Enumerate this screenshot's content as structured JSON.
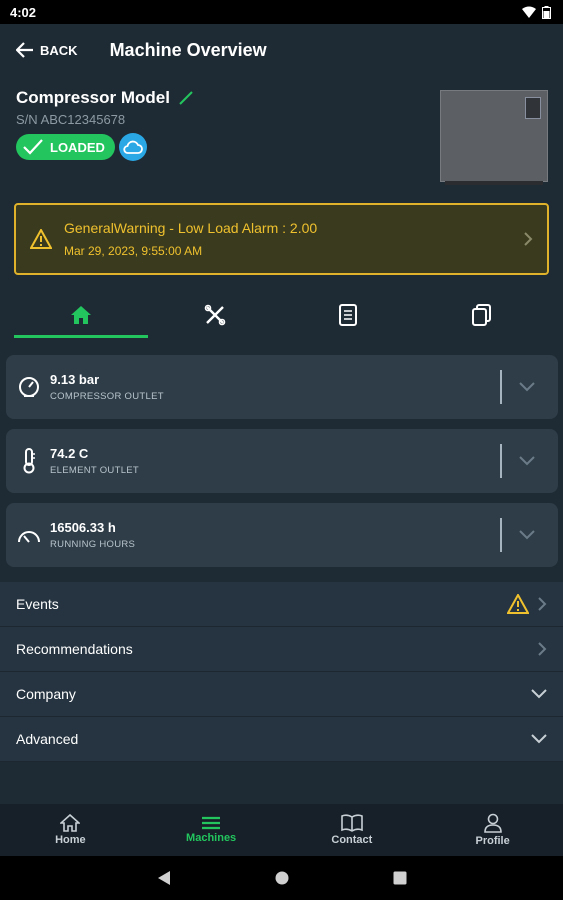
{
  "status_bar": {
    "time": "4:02"
  },
  "appbar": {
    "back_label": "BACK",
    "title": "Machine Overview"
  },
  "machine": {
    "model": "Compressor Model",
    "serial": "S/N ABC12345678",
    "status_badge": "LOADED"
  },
  "alarm": {
    "title": "GeneralWarning - Low Load Alarm : 2.00",
    "date": "Mar 29, 2023, 9:55:00 AM"
  },
  "tabs": [
    {
      "icon": "home-icon",
      "active": true
    },
    {
      "icon": "tools-icon",
      "active": false
    },
    {
      "icon": "manual-icon",
      "active": false
    },
    {
      "icon": "documents-icon",
      "active": false
    }
  ],
  "metrics": [
    {
      "value": "9.13 bar",
      "label": "COMPRESSOR OUTLET",
      "icon": "pressure-gauge-icon"
    },
    {
      "value": "74.2 C",
      "label": "ELEMENT OUTLET",
      "icon": "thermometer-icon"
    },
    {
      "value": "16506.33 h",
      "label": "RUNNING HOURS",
      "icon": "speedometer-icon"
    }
  ],
  "list": [
    {
      "label": "Events",
      "icon": "chevron-right-icon"
    },
    {
      "label": "Recommendations",
      "icon": "chevron-right-icon"
    },
    {
      "label": "Company",
      "icon": "chevron-down-icon"
    },
    {
      "label": "Advanced",
      "icon": "chevron-down-icon"
    }
  ],
  "bottom_nav": [
    {
      "label": "Home",
      "icon": "home-icon"
    },
    {
      "label": "Machines",
      "icon": "list-icon",
      "active": true
    },
    {
      "label": "Contact",
      "icon": "book-icon"
    },
    {
      "label": "Profile",
      "icon": "person-icon"
    }
  ],
  "colors": {
    "accent": "#22c55e",
    "warning": "#f0c12e",
    "background": "#1f2b34",
    "card": "#2e3d48"
  }
}
